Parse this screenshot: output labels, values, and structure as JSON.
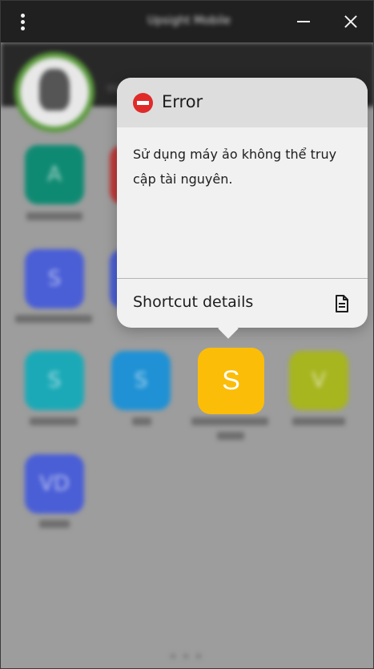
{
  "window": {
    "title": "Upsight Mobile"
  },
  "background_apps": [
    {
      "letter": "A",
      "color": "#0f8a72"
    },
    {
      "letter": "",
      "color": "#c03a3a"
    },
    {
      "letter": "S",
      "color": "#4a5ed6"
    },
    {
      "letter": "",
      "color": "#4a5ed6"
    },
    {
      "letter": "S",
      "color": "#1ba9b7"
    },
    {
      "letter": "S",
      "color": "#1f91d4"
    },
    {
      "letter": "V",
      "color": "#a7b51f"
    },
    {
      "letter": "VD",
      "color": "#4a5ed6"
    }
  ],
  "focused_app": {
    "letter": "S",
    "color": "#fbbd08"
  },
  "error_popup": {
    "icon": "no-entry-icon",
    "title": "Error",
    "message": "Sử dụng máy ảo không thể truy cập tài nguyên.",
    "details_label": "Shortcut details",
    "details_icon": "document-icon"
  },
  "colors": {
    "error": "#e02a2a",
    "titlebar": "#202020",
    "popup_bg": "#f1f1f1",
    "popup_header": "#dddddd"
  }
}
